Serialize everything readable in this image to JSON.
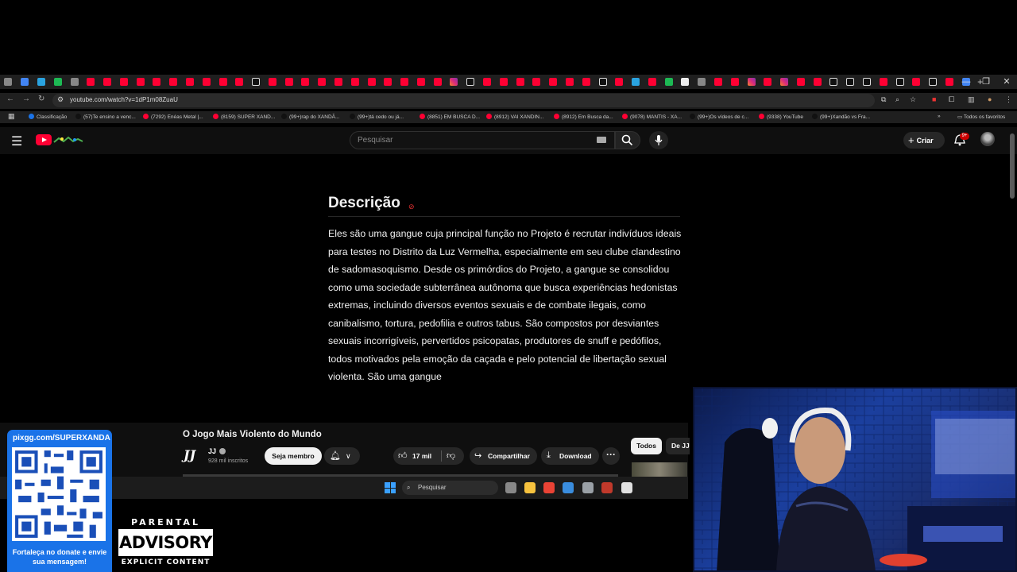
{
  "browser": {
    "url": "youtube.com/watch?v=1dP1m08ZuaU",
    "tab_favicons": [
      "gg",
      "blue",
      "green",
      "gray",
      "yt",
      "yt",
      "yt",
      "yt",
      "yt",
      "yt",
      "yt",
      "yt",
      "yt",
      "yt",
      "tt",
      "yt",
      "yt",
      "yt",
      "yt",
      "yt",
      "yt",
      "yt",
      "yt",
      "yt",
      "yt",
      "yt",
      "ig",
      "tt",
      "yt",
      "yt",
      "yt",
      "yt",
      "yt",
      "yt",
      "yt",
      "tt",
      "yt",
      "blue",
      "yt",
      "green",
      "white",
      "gray",
      "yt",
      "yt",
      "ig",
      "yt",
      "ig",
      "yt",
      "yt",
      "tt",
      "tt",
      "tt",
      "yt",
      "tt",
      "yt",
      "tt",
      "yt",
      "gg"
    ],
    "all_bookmarks_label": "Todos os favoritos",
    "bookmarks": [
      {
        "label": "Classificação",
        "color": "#1a73e8"
      },
      {
        "label": "(57)Te ensino a venc...",
        "color": "#111"
      },
      {
        "label": "(7292) Enéas Metal |...",
        "color": "#ff0033"
      },
      {
        "label": "(8159) SUPER XAND...",
        "color": "#ff0033"
      },
      {
        "label": "(99+)rap do XANDÃ...",
        "color": "#111"
      },
      {
        "label": "(99+)tá cedo ou já...",
        "color": "#111"
      },
      {
        "label": "(8851) EM BUSCA D...",
        "color": "#ff0033"
      },
      {
        "label": "(8912) VAI XANDIN...",
        "color": "#ff0033"
      },
      {
        "label": "(8912) Em Busca da...",
        "color": "#ff0033"
      },
      {
        "label": "(9078) MANTIS - XA...",
        "color": "#ff0033"
      },
      {
        "label": "(99+)Os vídeos de c...",
        "color": "#111"
      },
      {
        "label": "(9338) YouTube",
        "color": "#ff0033"
      },
      {
        "label": "(99+)Xandão vs Fra...",
        "color": "#111"
      }
    ]
  },
  "youtube": {
    "search_placeholder": "Pesquisar",
    "create_label": "Criar",
    "notification_count": "9+",
    "description_title": "Descrição",
    "description_text": "Eles são uma gangue cuja principal função no Projeto é recrutar indivíduos ideais para testes no Distrito da Luz Vermelha, especialmente em seu clube clandestino de sadomasoquismo. Desde os primórdios do Projeto, a gangue se consolidou como uma sociedade subterrânea autônoma que busca experiências hedonistas extremas, incluindo diversos eventos sexuais e de combate ilegais, como canibalismo, tortura, pedofilia e outros tabus. São compostos por desviantes sexuais incorrigíveis, pervertidos psicopatas, produtores de snuff e pedófilos, todos motivados pela emoção da caçada e pelo potencial de libertação sexual violenta. São uma gangue",
    "video_title": "O Jogo Mais Violento do Mundo",
    "channel_logo": "JJ",
    "channel_name": "JJ",
    "subscribers": "928 mil inscritos",
    "join_label": "Seja membro",
    "like_count": "17 mil",
    "share_label": "Compartilhar",
    "download_label": "Download",
    "chip_all": "Todos",
    "chip_channel": "De JJ"
  },
  "taskbar": {
    "search_placeholder": "Pesquisar",
    "apps": [
      "#888",
      "#f6c23e",
      "#ea4335",
      "#3a8dde",
      "#9aa0a6",
      "#c0392b",
      "#e0e0e0"
    ]
  },
  "overlay": {
    "donate_url": "pixgg.com/SUPERXANDA",
    "donate_caption": "Fortaleça no donate e envie sua mensagem!",
    "advisory_top": "PARENTAL",
    "advisory_mid": "ADVISORY",
    "advisory_bottom": "EXPLICIT CONTENT"
  }
}
